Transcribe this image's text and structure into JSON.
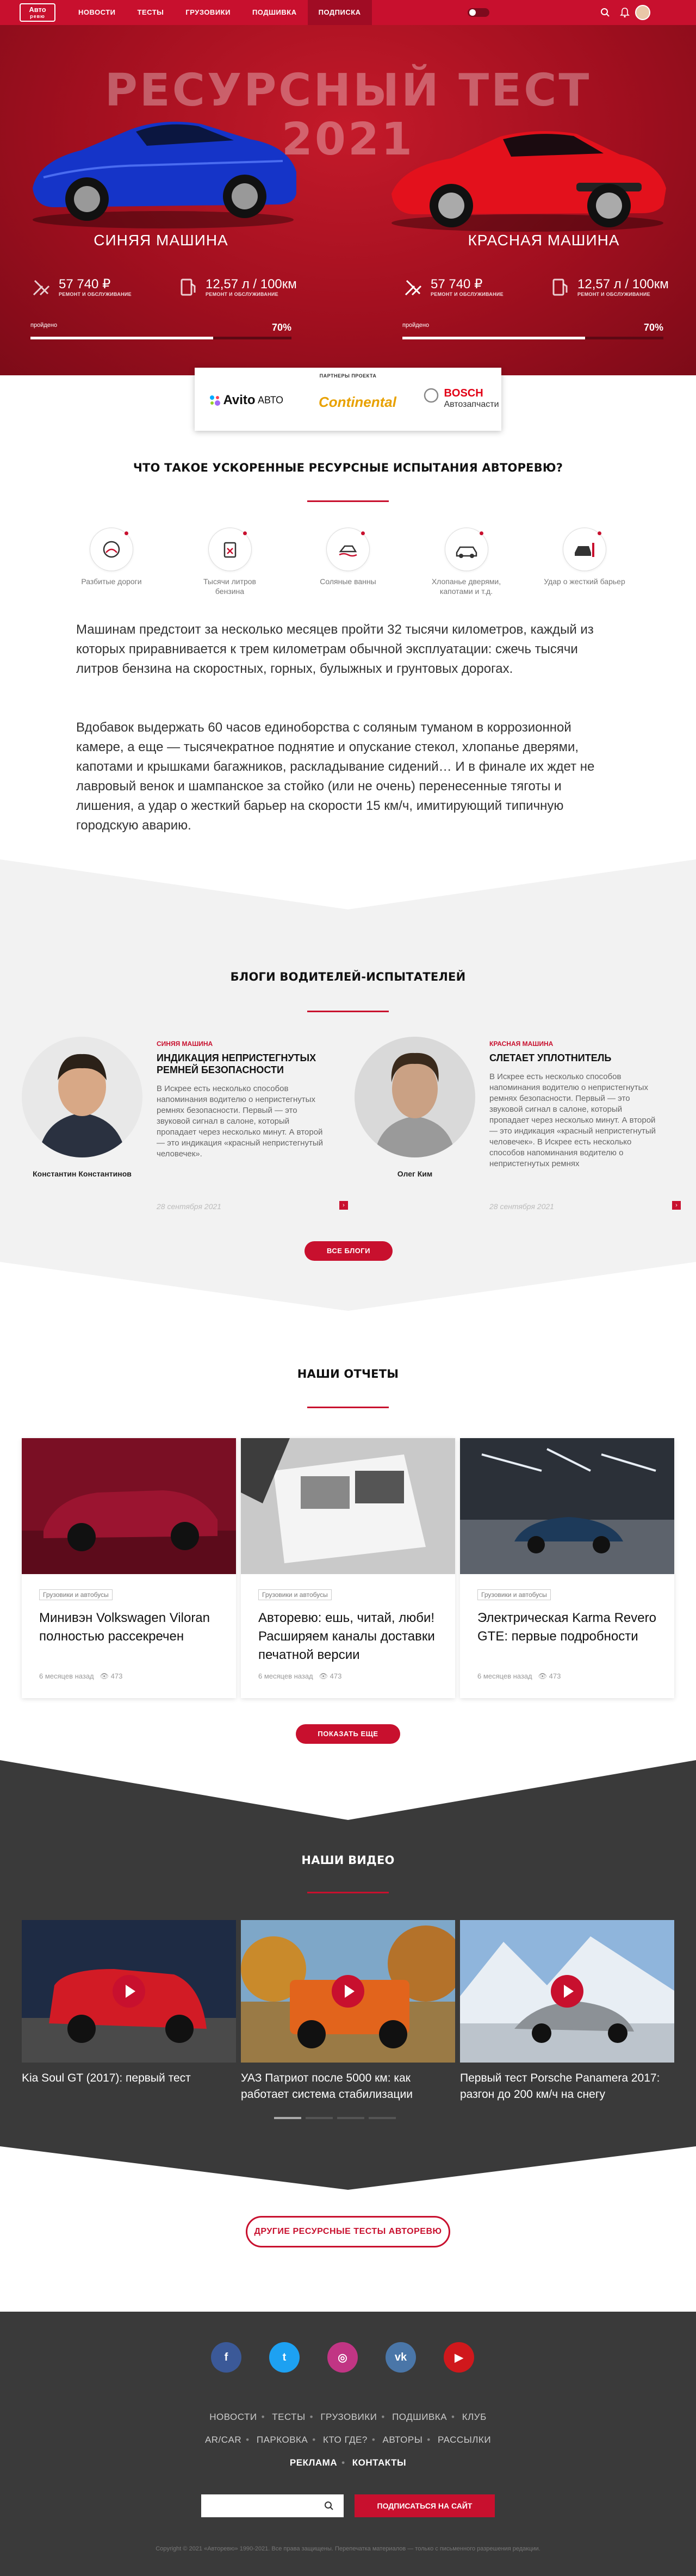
{
  "nav": {
    "logo_top": "Авто",
    "logo_bottom": "ревю",
    "items": [
      "НОВОСТИ",
      "ТЕСТЫ",
      "ГРУЗОВИКИ",
      "ПОДШИВКА",
      "ПОДПИСКА"
    ],
    "active_item": "ПОДПИСКА"
  },
  "hero": {
    "title_line1": "РЕСУРСНЫЙ ТЕСТ",
    "title_line2": "2021",
    "cars": [
      {
        "name": "СИНЯЯ МАШИНА",
        "cost_value": "57 740 ₽",
        "cost_label": "РЕМОНТ И ОБСЛУЖИВАНИЕ",
        "fuel_value": "12,57 л / 100км",
        "fuel_label": "РЕМОНТ И ОБСЛУЖИВАНИЕ",
        "progress_label": "пройдено",
        "progress_text": "70%",
        "progress": 0.7,
        "color": "#1a3fcc"
      },
      {
        "name": "КРАСНАЯ МАШИНА",
        "cost_value": "57 740 ₽",
        "cost_label": "РЕМОНТ И ОБСЛУЖИВАНИЕ",
        "fuel_value": "12,57 л / 100км",
        "fuel_label": "РЕМОНТ И ОБСЛУЖИВАНИЕ",
        "progress_label": "пройдено",
        "progress_text": "70%",
        "progress": 0.7,
        "color": "#d4121f"
      }
    ]
  },
  "partners": {
    "title": "ПАРТНЕРЫ ПРОЕКТА",
    "avito": "Avito",
    "avito_sub": "АВТО",
    "continental": "Continental",
    "bosch": "BOSCH",
    "bosch_sub": "Автозапчасти"
  },
  "about": {
    "title": "ЧТО ТАКОЕ УСКОРЕННЫЕ РЕСУРСНЫЕ ИСПЫТАНИЯ АВТОРЕВЮ?",
    "features": [
      {
        "label": "Разбитые дороги",
        "icon": "rough-road-icon"
      },
      {
        "label": "Тысячи литров бензина",
        "icon": "fuel-icon"
      },
      {
        "label": "Соляные ванны",
        "icon": "salt-bath-icon"
      },
      {
        "label": "Хлопанье дверями, капотами и т.д.",
        "icon": "doors-icon"
      },
      {
        "label": "Удар о жесткий барьер",
        "icon": "crash-icon"
      }
    ],
    "paragraph1": "Машинам предстоит за несколько месяцев пройти 32 тысячи километров, каждый из которых приравнивается к трем километрам обычной эксплуатации: сжечь тысячи литров бензина на скоростных, горных, булыжных и грунтовых дорогах.",
    "paragraph2": "Вдобавок выдержать 60 часов единоборства с соляным туманом в коррозионной камере, а еще — тысячекратное поднятие и опускание стекол, хлопанье дверями, капотами и крышками багажников, раскладывание сидений… И в финале их ждет не лавровый венок и шампанское за стойко (или не очень) перенесенные тяготы и лишения, а удар о жесткий барьер на скорости 15 км/ч, имитирующий типичную городскую аварию."
  },
  "blogs": {
    "title": "БЛОГИ ВОДИТЕЛЕЙ-ИСПЫТАТЕЛЕЙ",
    "items": [
      {
        "author": "Константин Константинов",
        "category": "СИНЯЯ МАШИНА",
        "title": "ИНДИКАЦИЯ НЕПРИСТЕГНУТЫХ РЕМНЕЙ БЕЗОПАСНОСТИ",
        "text": "В Искрее есть несколько способов напоминания водителю о непристегнутых ремнях безопасности. Первый — это звуковой сигнал в салоне, который пропадает через несколько минут. А второй — это индикация «красный непристегнутый человечек».",
        "date": "28 сентября 2021"
      },
      {
        "author": "Олег Ким",
        "category": "КРАСНАЯ МАШИНА",
        "title": "СЛЕТАЕТ УПЛОТНИТЕЛЬ",
        "text": "В Искрее есть несколько способов напоминания водителю о непристегнутых ремнях безопасности. Первый — это звуковой сигнал в салоне, который пропадает через несколько минут. А второй — это индикация «красный непристегнутый человечек». В Искрее есть несколько способов напоминания водителю о непристегнутых ремнях",
        "date": "28 сентября 2021"
      }
    ],
    "all_button": "ВСЕ БЛОГИ"
  },
  "reports": {
    "title": "НАШИ ОТЧЕТЫ",
    "items": [
      {
        "tag": "Грузовики и автобусы",
        "title": "Минивэн Volkswagen Viloran полностью рассекречен",
        "time": "6 месяцев назад",
        "views": "473"
      },
      {
        "tag": "Грузовики и автобусы",
        "title": "Авторевю: ешь, читай, люби! Расширяем каналы доставки печатной версии",
        "time": "6 месяцев назад",
        "views": "473"
      },
      {
        "tag": "Грузовики и автобусы",
        "title": "Электрическая Karma Revero GTE: первые подробности",
        "time": "6 месяцев назад",
        "views": "473"
      }
    ],
    "more_button": "ПОКАЗАТЬ ЕЩЕ"
  },
  "videos": {
    "title": "НАШИ ВИДЕО",
    "items": [
      {
        "title": "Kia Soul GT (2017): первый тест"
      },
      {
        "title": "УАЗ Патриот после 5000 км: как работает система стабилизации"
      },
      {
        "title": "Первый тест Porsche Panamera 2017: разгон до 200 км/ч на снегу"
      }
    ]
  },
  "other_tests_button": "ДРУГИЕ РЕСУРСНЫЕ ТЕСТЫ АВТОРЕВЮ",
  "footer": {
    "socials": [
      {
        "name": "facebook-icon",
        "glyph": "f",
        "color": "#3b5998"
      },
      {
        "name": "twitter-icon",
        "glyph": "t",
        "color": "#1da1f2"
      },
      {
        "name": "instagram-icon",
        "glyph": "◎",
        "color": "#c13584"
      },
      {
        "name": "vk-icon",
        "glyph": "vk",
        "color": "#4a76a8"
      },
      {
        "name": "youtube-icon",
        "glyph": "▶",
        "color": "#d0181c"
      }
    ],
    "links_row1": [
      "НОВОСТИ",
      "ТЕСТЫ",
      "ГРУЗОВИКИ",
      "ПОДШИВКА",
      "КЛУБ"
    ],
    "links_row2": [
      "AR/CAR",
      "ПАРКОВКА",
      "КТО ГДЕ?",
      "АВТОРЫ",
      "РАССЫЛКИ"
    ],
    "links_row3": [
      "РЕКЛАМА",
      "КОНТАКТЫ"
    ],
    "subscribe_placeholder": "",
    "subscribe_button": "ПОДПИСАТЬСЯ НА САЙТ",
    "copyright": "Copyright © 2021 «Авторевю» 1990-2021. Все права защищены. Перепечатка материалов — только с письменного разрешения редакции."
  }
}
